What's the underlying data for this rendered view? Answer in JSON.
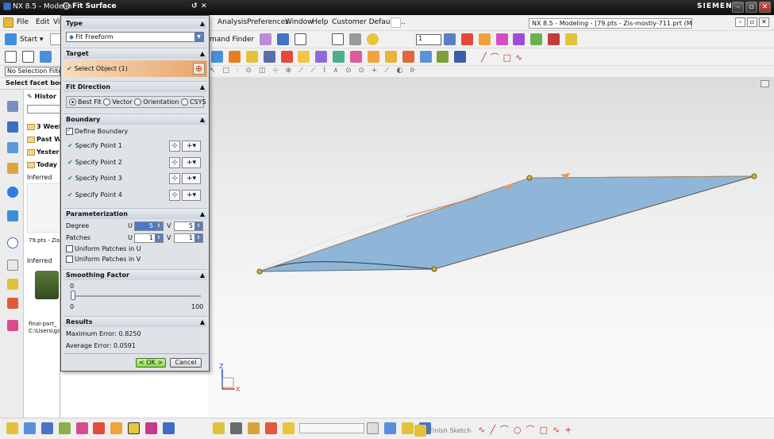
{
  "titlebar": {
    "app_title": "NX 8.5 - Modelin",
    "dialog_title": "Fit Surface",
    "brand": "SIEMENS"
  },
  "menu": {
    "items": [
      "File",
      "Edit",
      "Vi",
      "Analysis",
      "Preferences",
      "Window",
      "Help",
      "Customer Defaults..."
    ],
    "document_label": "NX 8.5 - Modeling - [79.pts - Zis-mostly-711.prt (Modified)]  (1)]"
  },
  "toolbar": {
    "start_label": "Start",
    "command_finder": "mand Finder",
    "layer_value": "1",
    "selection_filter": "No Selection Filte",
    "select_facet": "Select facet bod"
  },
  "navigator": {
    "history": "Histor",
    "groups": [
      "3 Week",
      "Past W",
      "Yester",
      "Today"
    ],
    "inferred": "Inferred",
    "file1": "79.pts - Zis",
    "file2": "final-part_",
    "path": "C:\\Users\\ga"
  },
  "dialog": {
    "type": {
      "header": "Type",
      "value": "Fit Freeform"
    },
    "target": {
      "header": "Target",
      "select_label": "Select Object (1)"
    },
    "fit_direction": {
      "header": "Fit Direction",
      "options": [
        "Best Fit",
        "Vector",
        "Orientation",
        "CSYS"
      ]
    },
    "boundary": {
      "header": "Boundary",
      "define_label": "Define Boundary",
      "points": [
        "Specify Point 1",
        "Specify Point 2",
        "Specify Point 3",
        "Specify Point 4"
      ]
    },
    "parameterization": {
      "header": "Parameterization",
      "degree_label": "Degree",
      "patches_label": "Patches",
      "u_label": "U",
      "v_label": "V",
      "degree_u": "5",
      "degree_v": "5",
      "patches_u": "1",
      "patches_v": "1",
      "uniform_u": "Uniform Patches in U",
      "uniform_v": "Uniform Patches in V"
    },
    "smoothing": {
      "header": "Smoothing Factor",
      "value": "0",
      "min": "0",
      "max": "100",
      "level_fraction": 0
    },
    "results": {
      "header": "Results",
      "max_error": "Maximum Error: 0.8250",
      "avg_error": "Average Error: 0.0591"
    },
    "buttons": {
      "ok": "< OK >",
      "cancel": "Cancel"
    }
  },
  "graphics": {
    "axis_z": "Z",
    "axis_x": "X",
    "surface_color": "#8fb6d8"
  },
  "bottom": {
    "finish_sketch": "Finish Sketch"
  }
}
